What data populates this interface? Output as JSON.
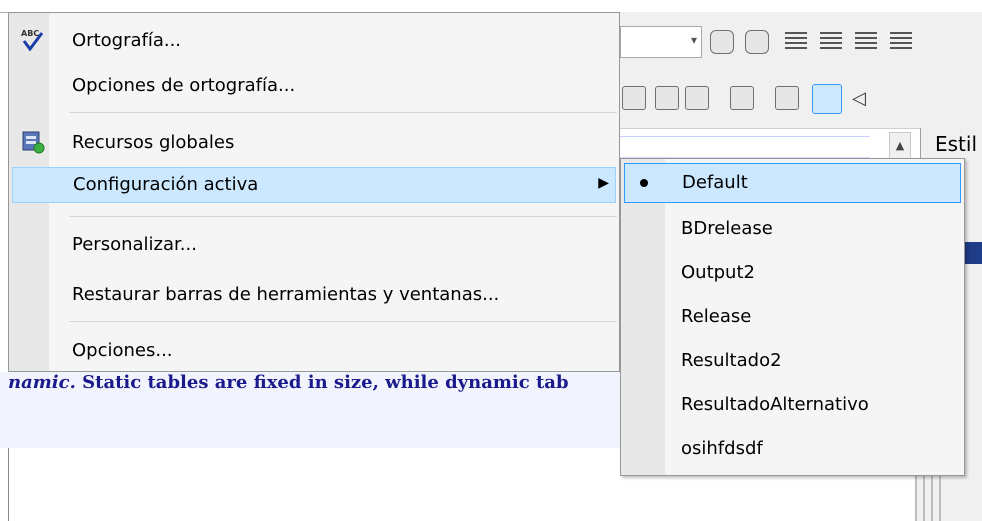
{
  "main_menu": {
    "items": [
      {
        "label": "Ortografía...",
        "icon": "spellcheck-icon"
      },
      {
        "label": "Opciones de ortografía..."
      },
      {
        "label": "Recursos globales",
        "icon": "global-resources-icon"
      },
      {
        "label": "Configuración activa",
        "has_submenu": true,
        "highlighted": true
      },
      {
        "label": "Personalizar..."
      },
      {
        "label": "Restaurar barras de herramientas y ventanas..."
      },
      {
        "label": "Opciones..."
      }
    ],
    "submenu_arrow": "▶"
  },
  "submenu": {
    "items": [
      {
        "label": "Default",
        "selected": true
      },
      {
        "label": "BDrelease"
      },
      {
        "label": "Output2"
      },
      {
        "label": "Release"
      },
      {
        "label": "Resultado2"
      },
      {
        "label": "ResultadoAlternativo"
      },
      {
        "label": "osihfdsdf"
      }
    ]
  },
  "background": {
    "doc_text_italic": "namic.",
    "doc_text_rest": " Static tables are fixed in size, while dynamic tab",
    "right_panel_label": "Estil",
    "scroll_up": "▲",
    "combo_arrow": "▾"
  },
  "colors": {
    "highlight": "#cce8ff",
    "highlight_border": "#99d1ff",
    "doc_text": "#1a1a8c"
  }
}
